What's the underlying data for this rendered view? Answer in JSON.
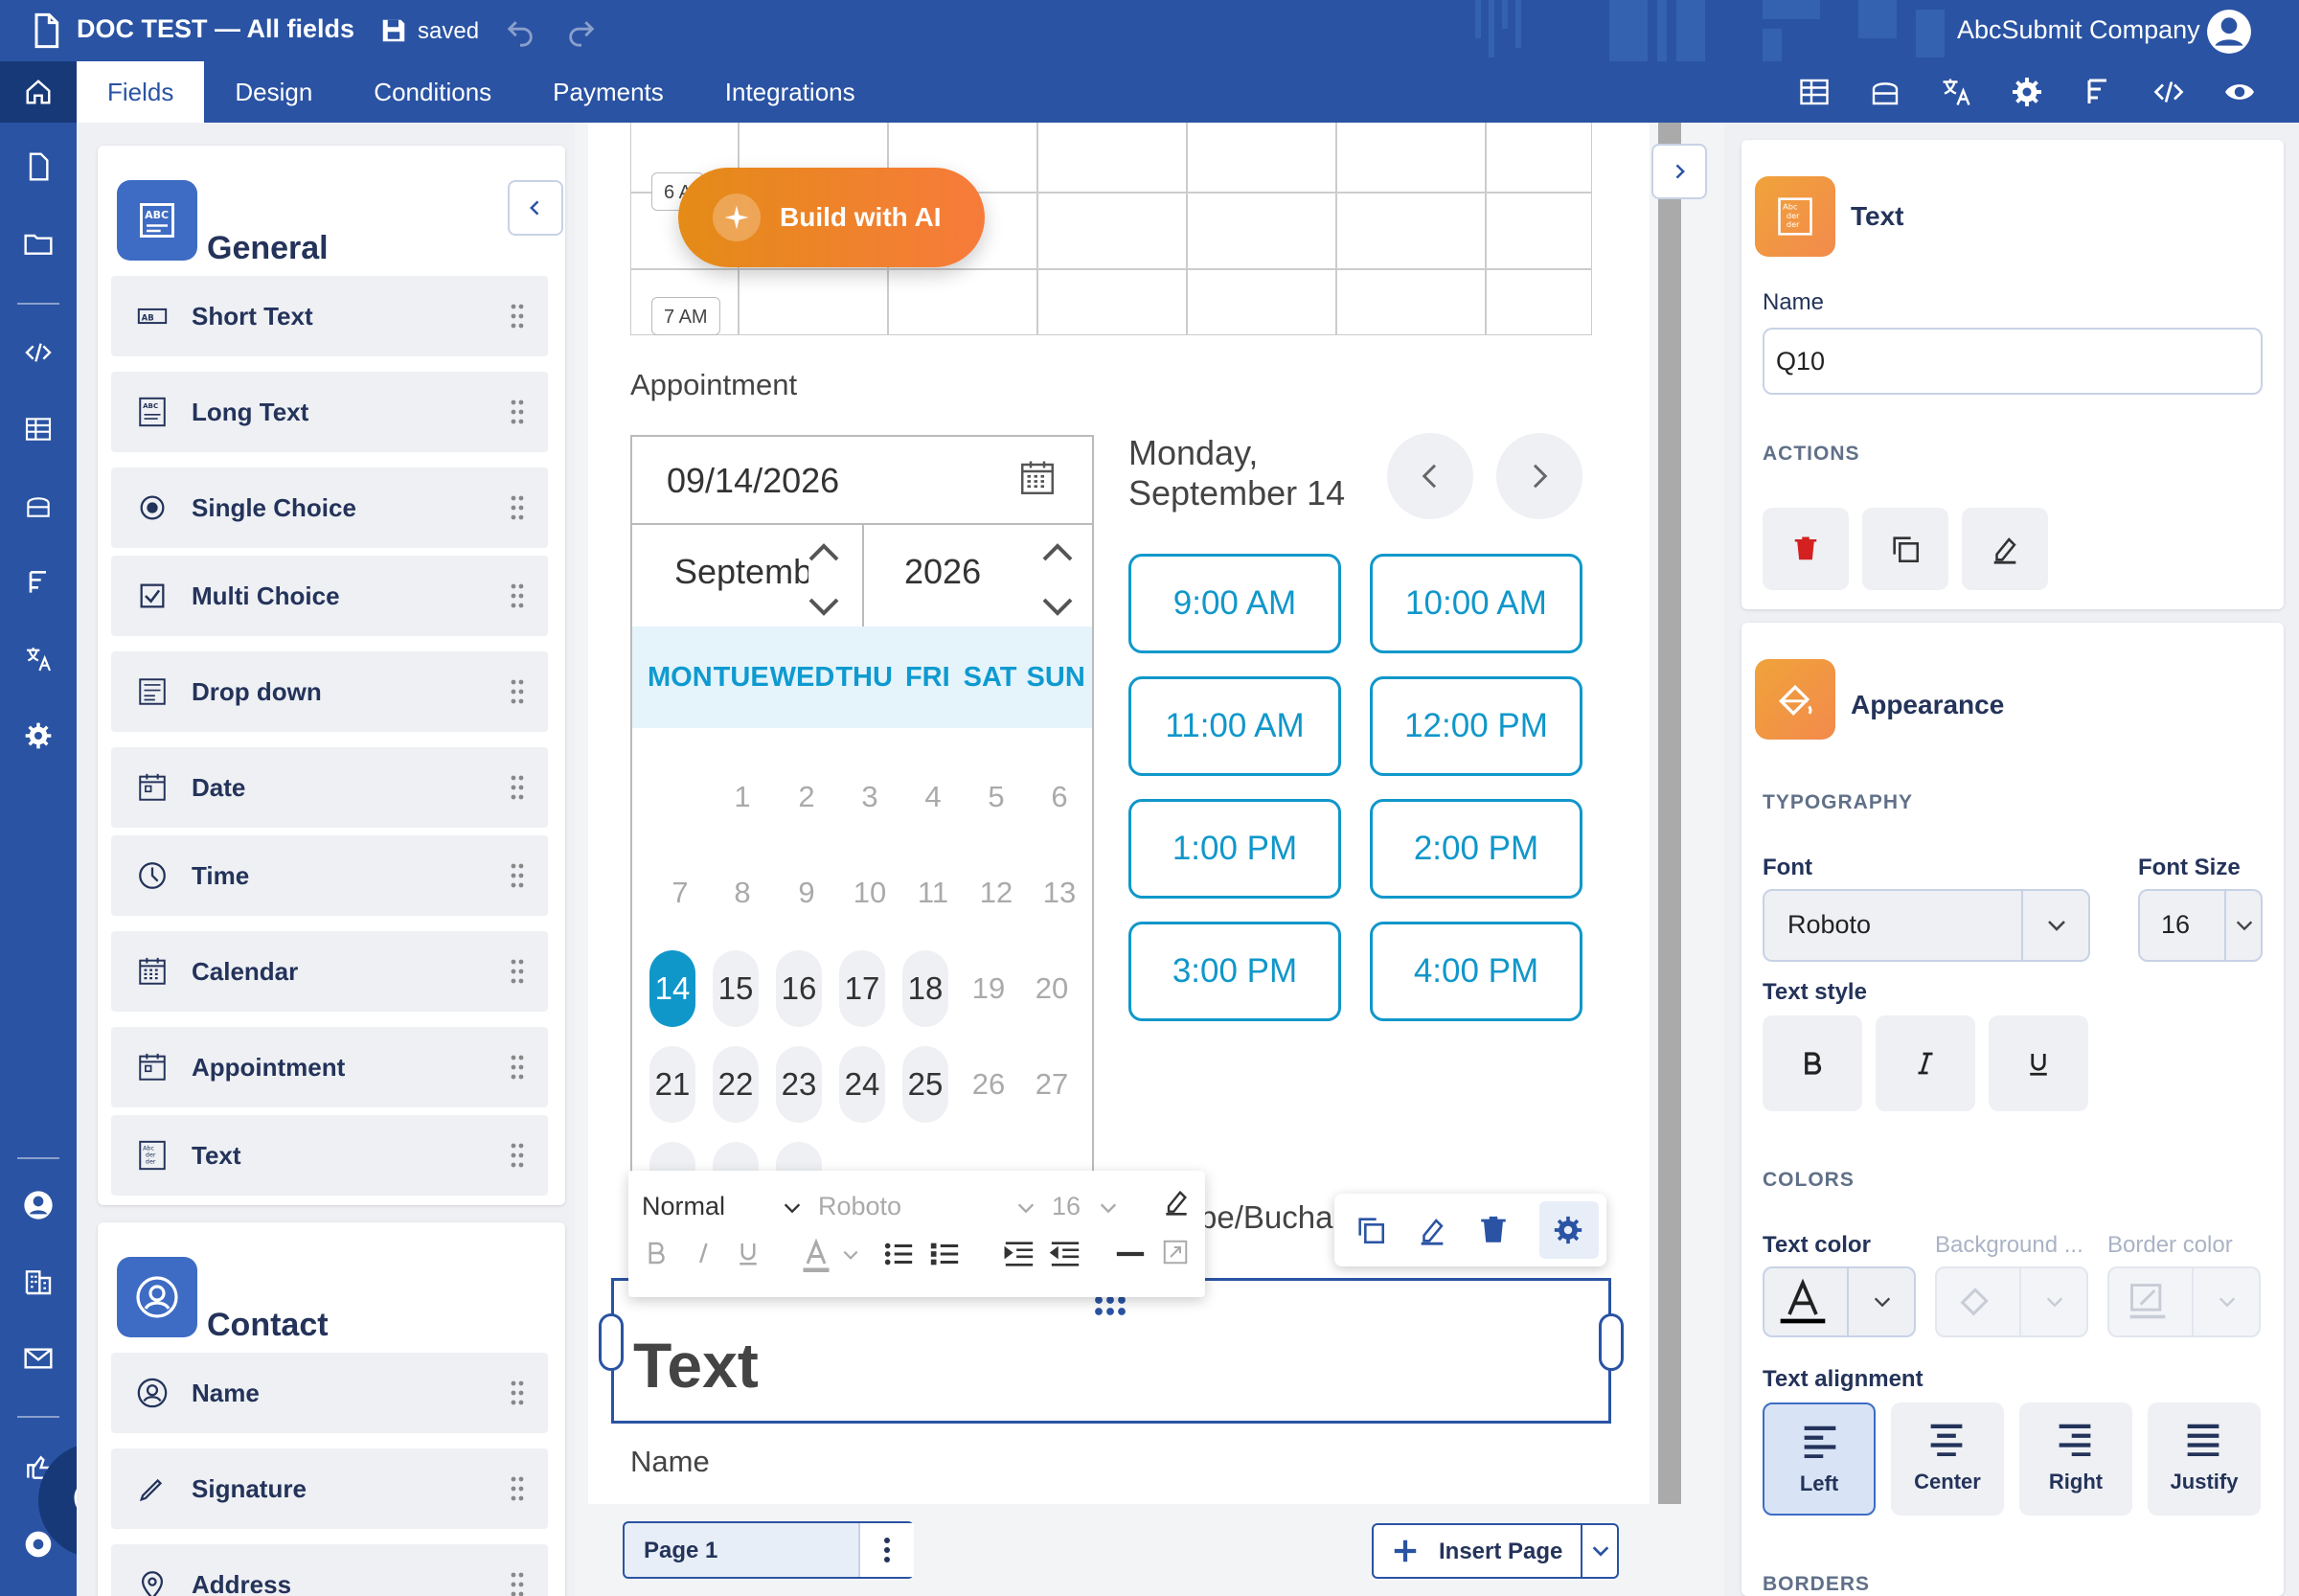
{
  "header": {
    "doc_title": "DOC TEST — All fields",
    "save_status": "saved",
    "company": "AbcSubmit Company",
    "tabs": [
      "Fields",
      "Design",
      "Conditions",
      "Payments",
      "Integrations"
    ],
    "active_tab": "Fields",
    "toolbar_icons": [
      "database-icon",
      "form-icon",
      "translate-icon",
      "gear-icon",
      "flow-icon",
      "code-icon",
      "preview-eye-icon"
    ]
  },
  "left_rail": {
    "icons": [
      "document-icon",
      "folder-icon",
      "code-icon",
      "database-icon",
      "form-icon",
      "flow-icon",
      "translate-icon",
      "gear-icon",
      "user-icon",
      "building-icon",
      "mail-icon",
      "share-icon",
      "support-icon"
    ]
  },
  "palette": {
    "general": {
      "title": "General",
      "items": [
        "Short Text",
        "Long Text",
        "Single Choice",
        "Multi Choice",
        "Drop down",
        "Date",
        "Time",
        "Calendar",
        "Appointment",
        "Text"
      ]
    },
    "contact": {
      "title": "Contact",
      "items": [
        "Name",
        "Signature",
        "Address"
      ]
    }
  },
  "canvas": {
    "time_labels": [
      "6 A",
      "7 AM"
    ],
    "ai_button": "Build with AI",
    "appointment": {
      "label": "Appointment",
      "date_value": "09/14/2026",
      "month": "September",
      "year": "2026",
      "weekdays": [
        "MON",
        "TUE",
        "WED",
        "THU",
        "FRI",
        "SAT",
        "SUN"
      ],
      "weeks": [
        [
          "",
          "1",
          "2",
          "3",
          "4",
          "5",
          "6"
        ],
        [
          "7",
          "8",
          "9",
          "10",
          "11",
          "12",
          "13"
        ],
        [
          "14",
          "15",
          "16",
          "17",
          "18",
          "19",
          "20"
        ],
        [
          "21",
          "22",
          "23",
          "24",
          "25",
          "26",
          "27"
        ]
      ],
      "selected_day": "14",
      "selected_date_line1": "Monday,",
      "selected_date_line2": "September 14",
      "slots": [
        "9:00 AM",
        "10:00 AM",
        "11:00 AM",
        "12:00 PM",
        "1:00 PM",
        "2:00 PM",
        "3:00 PM",
        "4:00 PM"
      ]
    },
    "editor_toolbar": {
      "format": "Normal",
      "font": "Roboto",
      "size": "16"
    },
    "partial_label": "pe/Bucha",
    "text_field_value": "Text",
    "name_label": "Name",
    "page_tab": "Page 1",
    "insert_page": "Insert Page"
  },
  "properties": {
    "field_type": "Text",
    "name_label": "Name",
    "name_value": "Q10",
    "actions_label": "ACTIONS",
    "appearance_title": "Appearance",
    "typography_label": "TYPOGRAPHY",
    "font_label": "Font",
    "font_value": "Roboto",
    "font_size_label": "Font Size",
    "font_size_value": "16",
    "text_style_label": "Text style",
    "colors_label": "COLORS",
    "text_color_label": "Text color",
    "background_label": "Background ...",
    "border_color_label": "Border color",
    "alignment_label": "Text alignment",
    "alignments": [
      "Left",
      "Center",
      "Right",
      "Justify"
    ],
    "active_alignment": "Left",
    "borders_label": "BORDERS"
  },
  "colors": {
    "brand_blue": "#2a53a3",
    "accent_cyan": "#1097ca",
    "danger_red": "#d42020",
    "ai_orange": "#e48b17"
  }
}
